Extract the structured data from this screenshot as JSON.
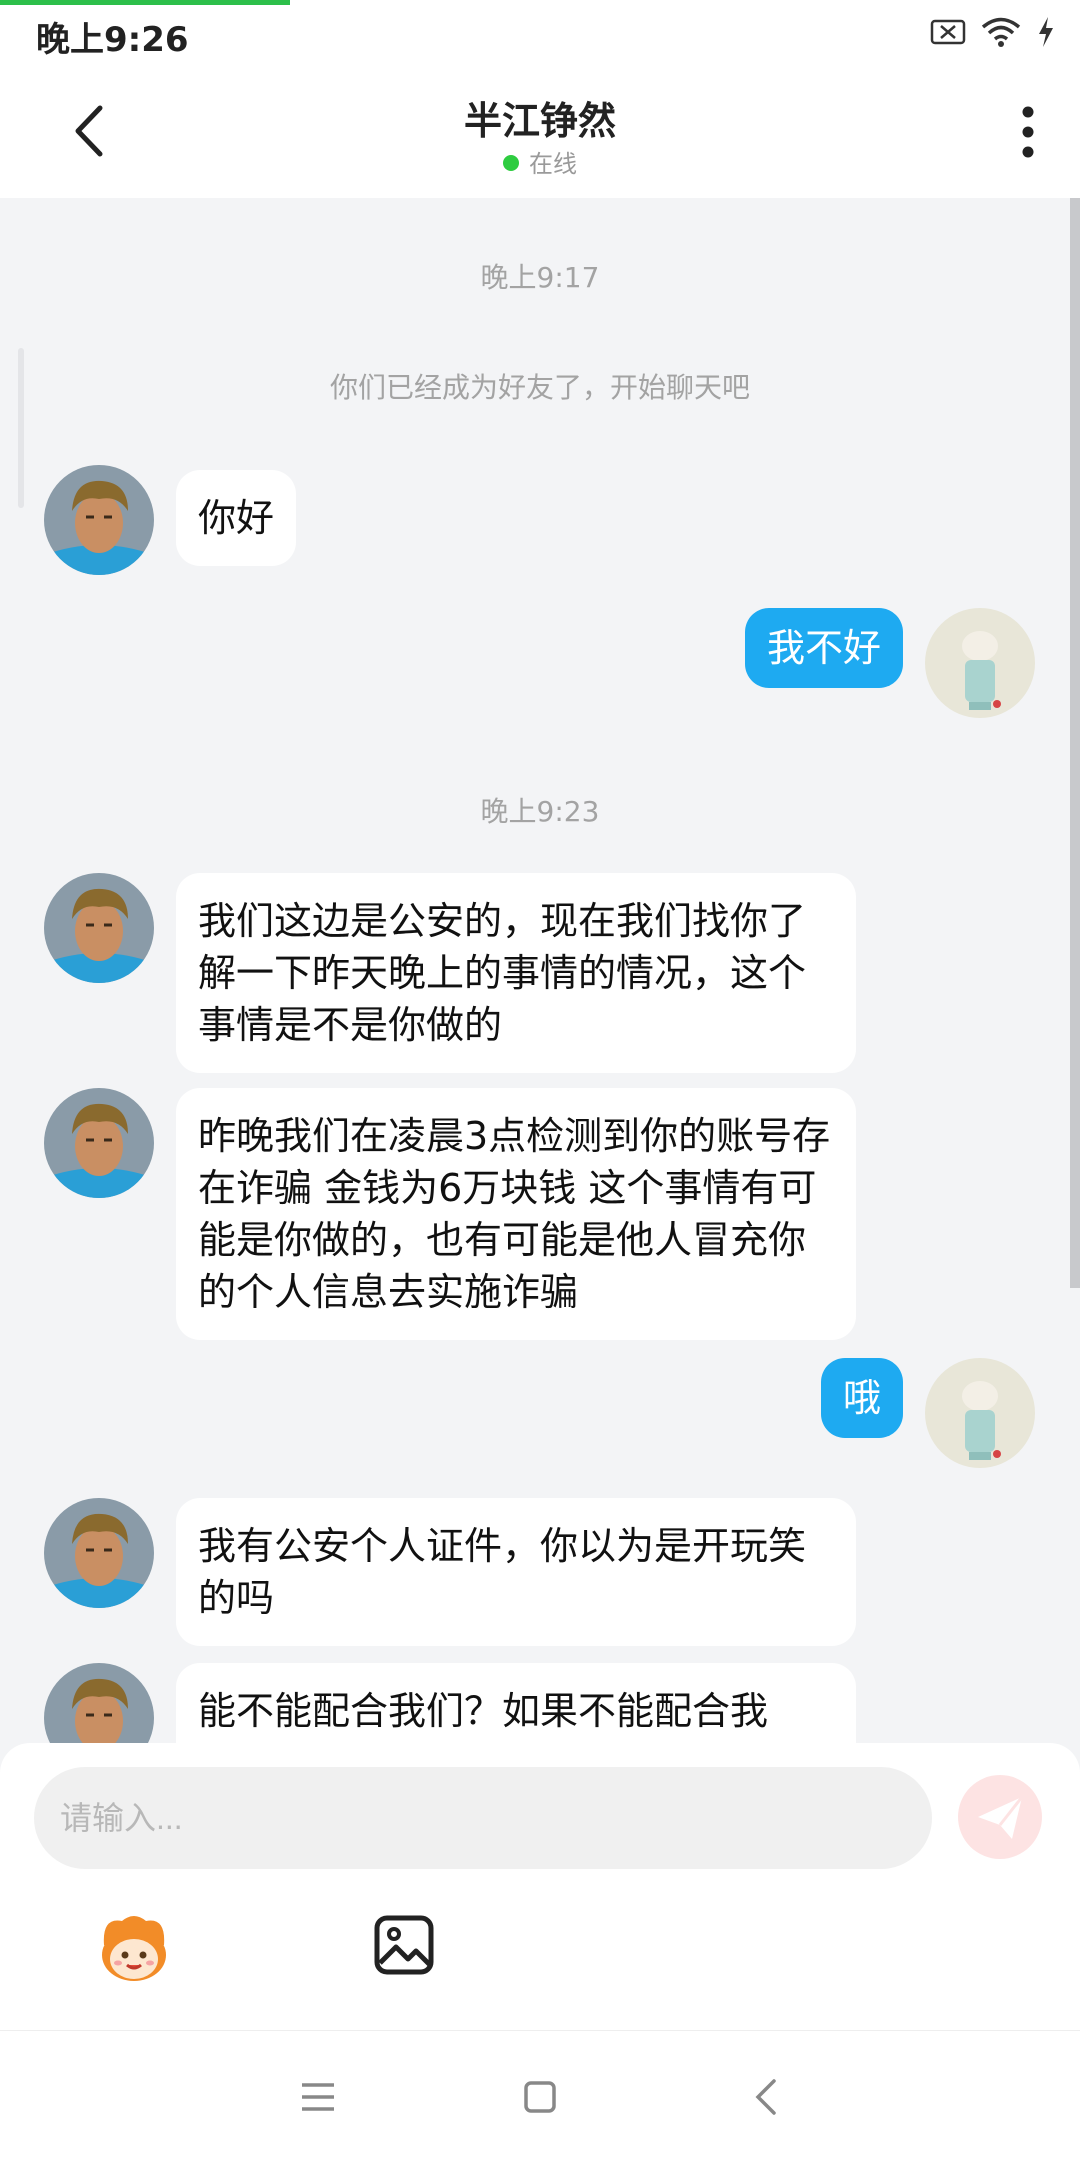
{
  "status_bar": {
    "time": "晚上9:26"
  },
  "header": {
    "title": "半江铮然",
    "status": "在线"
  },
  "chat": {
    "time_1": "晚上9:17",
    "system_message": "你们已经成为好友了，开始聊天吧",
    "time_2": "晚上9:23",
    "messages": [
      {
        "from": "other",
        "text": "你好"
      },
      {
        "from": "me",
        "text": "我不好"
      },
      {
        "from": "other",
        "text": "我们这边是公安的，现在我们找你了解一下昨天晚上的事情的情况，这个事情是不是你做的"
      },
      {
        "from": "other",
        "text": "昨晚我们在凌晨3点检测到你的账号存在诈骗 金钱为6万块钱 这个事情有可能是你做的，也有可能是他人冒充你的个人信息去实施诈骗"
      },
      {
        "from": "me",
        "text": "哦"
      },
      {
        "from": "other",
        "text": "我有公安个人证件，你以为是开玩笑的吗"
      },
      {
        "from": "other",
        "text": "能不能配合我们？如果不能配合我们，我们现在出发作案用进行对你移"
      }
    ]
  },
  "input": {
    "placeholder": "请输入..."
  },
  "colors": {
    "accent": "#1eaaf1",
    "online": "#2ecc40",
    "background": "#f3f4f6"
  }
}
